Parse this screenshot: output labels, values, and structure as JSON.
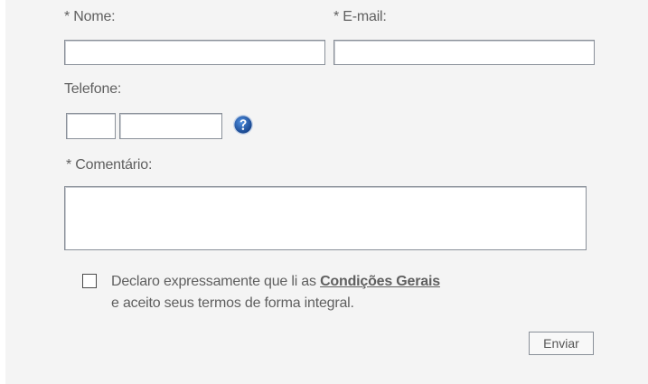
{
  "form": {
    "name_label": "* Nome:",
    "name_value": "",
    "email_label": "* E-mail:",
    "email_value": "",
    "phone_label": "Telefone:",
    "phone_area_value": "",
    "phone_number_value": "",
    "help_icon": "question-circle",
    "comment_label": "* Comentário:",
    "comment_value": "",
    "consent_text_before": "Declaro expressamente que li as ",
    "consent_link": "Condições Gerais",
    "consent_text_after": "e aceito seus termos de forma integral.",
    "consent_checked": false,
    "submit_label": "Enviar"
  },
  "colors": {
    "background": "#f4f4f4",
    "label_text": "#5f5f5f",
    "field_border": "#8a9099",
    "help_icon_blue": "#1d5fb4"
  }
}
